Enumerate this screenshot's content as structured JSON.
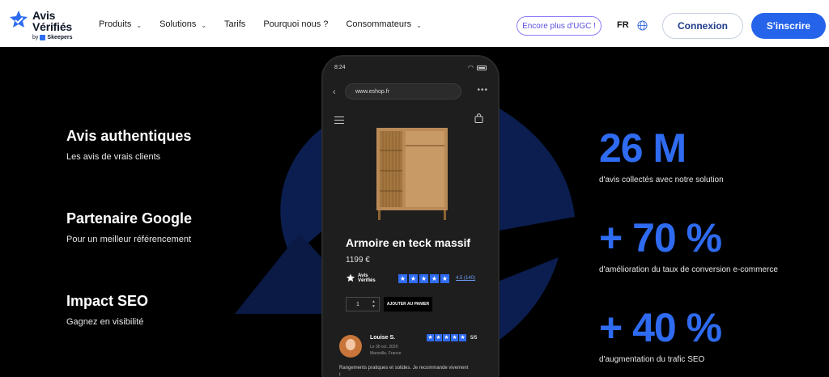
{
  "brand": {
    "line1": "Avis",
    "line2": "Vérifiés",
    "by": "by",
    "parent": "Skeepers"
  },
  "nav": {
    "items": [
      {
        "label": "Produits",
        "has_dropdown": true
      },
      {
        "label": "Solutions",
        "has_dropdown": true
      },
      {
        "label": "Tarifs",
        "has_dropdown": false
      },
      {
        "label": "Pourquoi nous ?",
        "has_dropdown": false
      },
      {
        "label": "Consommateurs",
        "has_dropdown": true
      }
    ],
    "ugc_label": "Encore plus d'UGC !",
    "language": "FR",
    "login_label": "Connexion",
    "signup_label": "S'inscrire"
  },
  "features": [
    {
      "title": "Avis authentiques",
      "subtitle": "Les avis de vrais clients"
    },
    {
      "title": "Partenaire Google",
      "subtitle": "Pour un meilleur référencement"
    },
    {
      "title": "Impact SEO",
      "subtitle": "Gagnez en visibilité"
    }
  ],
  "stats": [
    {
      "value": "26 M",
      "caption": "d'avis collectés avec notre solution"
    },
    {
      "value": "+ 70 %",
      "caption": "d'amélioration du taux de conversion e-commerce"
    },
    {
      "value": "+ 40 %",
      "caption": "d'augmentation du trafic SEO"
    }
  ],
  "phone": {
    "time": "8:24",
    "url": "www.eshop.fr",
    "product_name": "Armoire en teck massif",
    "price": "1199 €",
    "mini_brand_line1": "Avis",
    "mini_brand_line2": "Vérifiés",
    "rating_link": "4.5 (140)",
    "rating_stars": 5,
    "quantity": "1",
    "add_to_cart": "AJOUTER AU PANIER",
    "review": {
      "author": "Louise S.",
      "date": "Le 30 oct. 2020",
      "location": "Marseille, France",
      "score": "5/5",
      "stars": 5,
      "text": "Rangements pratiques et solides. Je recommande vivement !"
    }
  },
  "colors": {
    "accent": "#2563eb",
    "stat_blue": "#2f6bf0",
    "ugc_purple": "#8b7cf6",
    "hero_bg": "#000000",
    "bg_logo": "#0b1e4f"
  }
}
